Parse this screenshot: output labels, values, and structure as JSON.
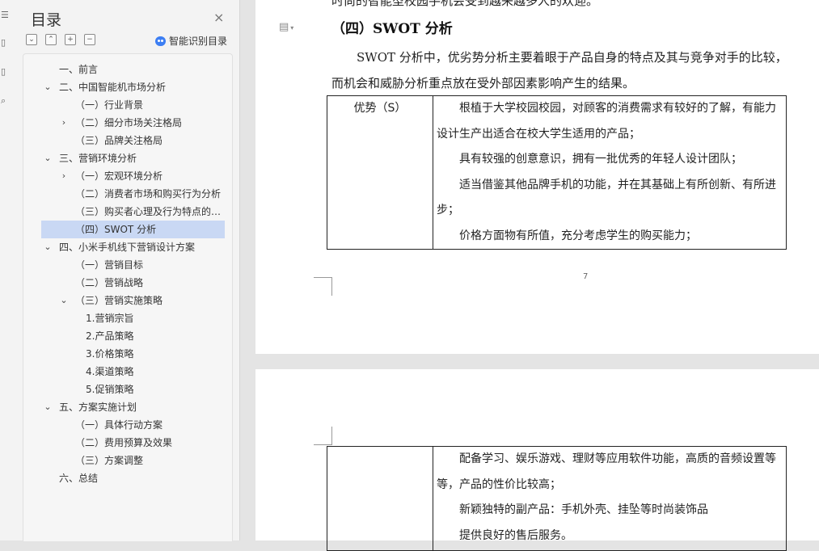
{
  "toc": {
    "title": "目录",
    "close_icon": "×",
    "tools": [
      "⌄",
      "⌃",
      "+",
      "−"
    ],
    "smart_label": "智能识别目录",
    "items": [
      {
        "label": "一、前言",
        "level": 0,
        "chevron": ""
      },
      {
        "label": "二、中国智能机市场分析",
        "level": 0,
        "chevron": "⌄"
      },
      {
        "label": "（一）行业背景",
        "level": 1,
        "chevron": ""
      },
      {
        "label": "（二）细分市场关注格局",
        "level": 1,
        "chevron": "›"
      },
      {
        "label": "（三）品牌关注格局",
        "level": 1,
        "chevron": ""
      },
      {
        "label": "三、营销环境分析",
        "level": 0,
        "chevron": "⌄"
      },
      {
        "label": "（一）宏观环境分析",
        "level": 1,
        "chevron": "›"
      },
      {
        "label": "（二）消费者市场和购买行为分析",
        "level": 1,
        "chevron": ""
      },
      {
        "label": "（三）购买者心理及行为特点的分 ...",
        "level": 1,
        "chevron": ""
      },
      {
        "label": "（四）SWOT 分析",
        "level": 1,
        "chevron": "",
        "active": true
      },
      {
        "label": "四、小米手机线下营销设计方案",
        "level": 0,
        "chevron": "⌄"
      },
      {
        "label": "（一）营销目标",
        "level": 1,
        "chevron": ""
      },
      {
        "label": "（二）营销战略",
        "level": 1,
        "chevron": ""
      },
      {
        "label": "（三）营销实施策略",
        "level": 1,
        "chevron": "⌄"
      },
      {
        "label": "1.营销宗旨",
        "level": 2,
        "chevron": ""
      },
      {
        "label": "2.产品策略",
        "level": 2,
        "chevron": ""
      },
      {
        "label": "3.价格策略",
        "level": 2,
        "chevron": ""
      },
      {
        "label": "4.渠道策略",
        "level": 2,
        "chevron": ""
      },
      {
        "label": "5.促销策略",
        "level": 2,
        "chevron": ""
      },
      {
        "label": "五、方案实施计划",
        "level": 0,
        "chevron": "⌄"
      },
      {
        "label": "（一）具体行动方案",
        "level": 1,
        "chevron": ""
      },
      {
        "label": "（二）费用预算及效果",
        "level": 1,
        "chevron": ""
      },
      {
        "label": "（三）方案调整",
        "level": 1,
        "chevron": ""
      },
      {
        "label": "六、总结",
        "level": 0,
        "chevron": ""
      }
    ]
  },
  "document": {
    "top_cut_text": "时尚的智能型校园手机会受到越来越多人的欢迎。",
    "heading": "（四）SWOT 分析",
    "para_line1": "SWOT 分析中，优劣势分析主要着眼于产品自身的特点及其与竞争对手的比较，",
    "para_line2": "而机会和威胁分析重点放在受外部因素影响产生的结果。",
    "table1": {
      "label": "优势（S）",
      "lines": [
        "　　根植于大学校园校园，对顾客的消费需求有较好的了解，有能力",
        "设计生产出适合在校大学生适用的产品；",
        "　　具有较强的创意意识，拥有一批优秀的年轻人设计团队；",
        "　　适当借鉴其他品牌手机的功能，并在其基础上有所创新、有所进",
        "步；",
        "　　价格方面物有所值，充分考虑学生的购买能力；"
      ]
    },
    "page_number": "7",
    "table2": {
      "label": "",
      "lines": [
        "　　配备学习、娱乐游戏、理财等应用软件功能，高质的音频设置等",
        "等，产品的性价比较高；",
        "　　新颖独特的副产品：手机外壳、挂坠等时尚装饰品",
        "　　提供良好的售后服务。"
      ]
    }
  }
}
